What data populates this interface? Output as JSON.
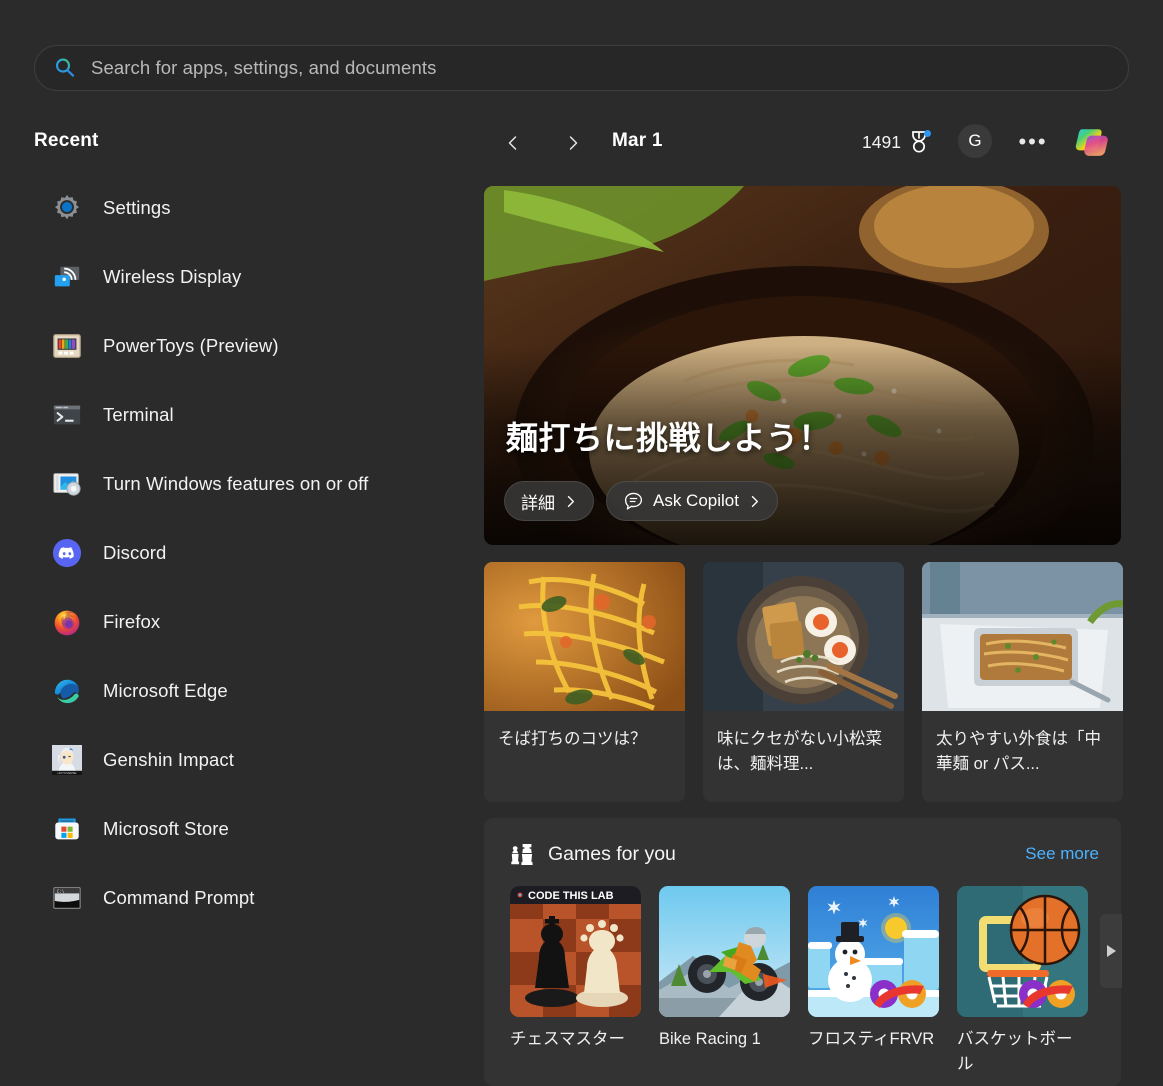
{
  "search": {
    "placeholder": "Search for apps, settings, and documents",
    "value": "",
    "icon": "search-icon"
  },
  "sidebar": {
    "heading": "Recent",
    "items": [
      {
        "label": "Settings",
        "icon": "settings-gear-icon"
      },
      {
        "label": "Wireless Display",
        "icon": "wireless-display-icon"
      },
      {
        "label": "PowerToys (Preview)",
        "icon": "powertoys-icon"
      },
      {
        "label": "Terminal",
        "icon": "terminal-icon"
      },
      {
        "label": "Turn Windows features on or off",
        "icon": "windows-features-icon"
      },
      {
        "label": "Discord",
        "icon": "discord-icon"
      },
      {
        "label": "Firefox",
        "icon": "firefox-icon"
      },
      {
        "label": "Microsoft Edge",
        "icon": "edge-icon"
      },
      {
        "label": "Genshin Impact",
        "icon": "genshin-impact-icon"
      },
      {
        "label": "Microsoft Store",
        "icon": "microsoft-store-icon"
      },
      {
        "label": "Command Prompt",
        "icon": "command-prompt-icon"
      }
    ]
  },
  "header": {
    "prev_icon": "chevron-left-icon",
    "next_icon": "chevron-right-icon",
    "date": "Mar 1",
    "rewards_points": "1491",
    "rewards_icon": "rewards-medal-icon",
    "avatar_initial": "G",
    "more_label": "•••",
    "copilot_icon": "copilot-icon"
  },
  "hero": {
    "title": "麺打ちに挑戦しよう！",
    "primary_button": "詳細",
    "copilot_button": "Ask Copilot",
    "copilot_icon": "chat-bubble-icon",
    "arrow_icon": "chevron-right-icon",
    "image_alt": "soba-noodle-bowl-photo"
  },
  "articles": [
    {
      "caption": "そば打ちのコツは？",
      "image_alt": "stir-fried-noodles-photo"
    },
    {
      "caption": "味にクセがない小松菜は、麺料理...",
      "image_alt": "ramen-with-eggs-photo"
    },
    {
      "caption": "太りやすい外食は「中華麺 or パス...",
      "image_alt": "takeout-noodle-container-photo"
    }
  ],
  "games": {
    "title": "Games for you",
    "icon": "chess-pieces-icon",
    "see_more": "See more",
    "scroll_next_icon": "play-triangle-icon",
    "tiles": [
      {
        "name": "チェスマスター",
        "art": "chess-board-art",
        "badge": "CODE THIS LAB"
      },
      {
        "name": "Bike Racing 1",
        "art": "motocross-art"
      },
      {
        "name": "フロスティFRVR",
        "art": "snowman-art"
      },
      {
        "name": "バスケットボール",
        "art": "basketball-hoop-art"
      }
    ]
  },
  "colors": {
    "background": "#2b2b2b",
    "card": "#333333",
    "search_field": "#272727",
    "link_blue": "#4cb3ff",
    "badge_blue": "#2e95f0",
    "text_primary": "#f2f2f2"
  }
}
